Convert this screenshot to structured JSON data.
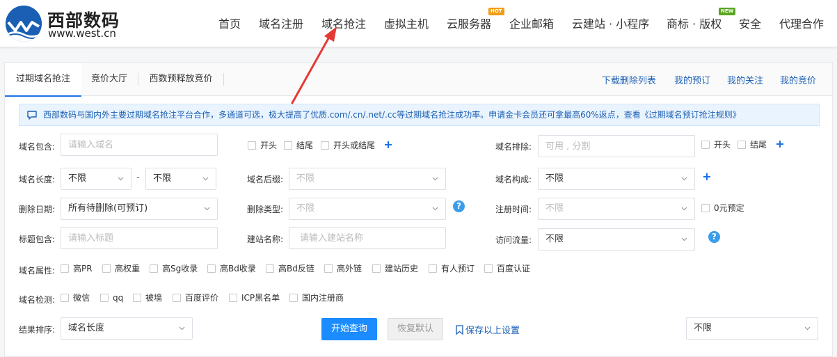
{
  "brand": {
    "name": "西部数码",
    "url": "www.west.cn",
    "color": "#1a5fb4"
  },
  "nav": {
    "items": [
      {
        "label": "首页"
      },
      {
        "label": "域名注册"
      },
      {
        "label": "域名抢注"
      },
      {
        "label": "虚拟主机"
      },
      {
        "label": "云服务器",
        "badge": "HOT"
      },
      {
        "label": "企业邮箱"
      },
      {
        "label": "云建站 · 小程序"
      },
      {
        "label": "商标 · 版权",
        "badge": "NEW"
      },
      {
        "label": "安全"
      },
      {
        "label": "代理合作"
      }
    ]
  },
  "tabs": {
    "items": [
      {
        "label": "过期域名抢注"
      },
      {
        "label": "竞价大厅"
      },
      {
        "label": "西数预释放竞价"
      }
    ],
    "active": "过期域名抢注",
    "links": [
      {
        "label": "下载删除列表"
      },
      {
        "label": "我的预订"
      },
      {
        "label": "我的关注"
      },
      {
        "label": "我的竞价"
      }
    ]
  },
  "notice": {
    "text": "西部数码与国内外主要过期域名抢注平台合作，多通道可选，极大提高了优质.com/.cn/.net/.cc等过期域名抢注成功率。申请金卡会员还可拿最高60%返点，查看《过期域名预订抢注规则》"
  },
  "form": {
    "domain_contains": {
      "label": "域名包含:",
      "placeholder": "请输入域名"
    },
    "position_checks": [
      "开头",
      "结尾",
      "开头或结尾"
    ],
    "domain_exclude": {
      "label": "域名排除:",
      "placeholder": "可用 , 分割",
      "checks": [
        "开头",
        "结尾"
      ]
    },
    "domain_length": {
      "label": "域名长度:",
      "min": "不限",
      "max": "不限",
      "separator": "-"
    },
    "domain_suffix": {
      "label": "域名后缀:",
      "value": "不限"
    },
    "domain_compose": {
      "label": "域名构成:",
      "value": "不限"
    },
    "delete_date": {
      "label": "删除日期:",
      "value": "所有待删除(可预订)"
    },
    "delete_type": {
      "label": "删除类型:",
      "value": "不限"
    },
    "reg_time": {
      "label": "注册时间:",
      "value": "不限",
      "check": "0元预定"
    },
    "title_contains": {
      "label": "标题包含:",
      "placeholder": "请输入标题"
    },
    "site_name": {
      "label": "建站名称:",
      "placeholder": "请输入建站名称"
    },
    "traffic": {
      "label": "访问流量:",
      "value": "不限"
    },
    "attributes": {
      "label": "域名属性:",
      "checks": [
        "高PR",
        "高权重",
        "高Sg收录",
        "高Bd收录",
        "高Bd反链",
        "高外链",
        "建站历史",
        "有人预订",
        "百度认证"
      ]
    },
    "detection": {
      "label": "域名检测:",
      "checks": [
        "微信",
        "qq",
        "被墙",
        "百度评价",
        "ICP黑名单",
        "国内注册商"
      ]
    },
    "sort": {
      "label": "结果排序:",
      "value": "域名长度"
    },
    "right_select": {
      "value": "不限"
    }
  },
  "actions": {
    "search": "开始查询",
    "reset": "恢复默认",
    "save": "保存以上设置"
  },
  "help_symbol": "?",
  "colors": {
    "primary": "#1a8cff",
    "link": "#1a5fb4",
    "arrow": "#e53935",
    "hot": "#f39c12",
    "new": "#5aa61f"
  }
}
